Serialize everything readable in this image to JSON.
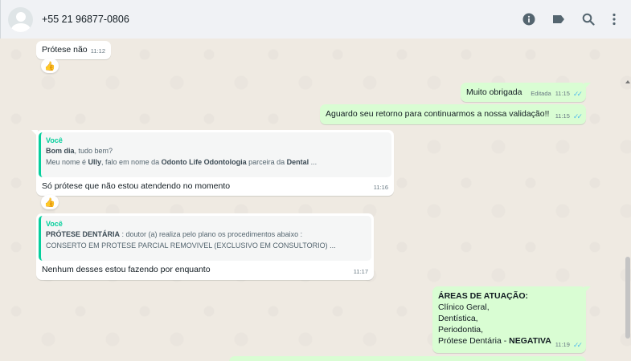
{
  "header": {
    "contact_name": "+55 21 96877-0806",
    "icons": [
      "info-icon",
      "label-icon",
      "search-icon",
      "menu-icon"
    ]
  },
  "colors": {
    "incoming": "#ffffff",
    "outgoing": "#d9fdd3",
    "accent": "#06cf9c",
    "ticks": "#53bdeb"
  },
  "messages": [
    {
      "dir": "in",
      "text": "Prótese não",
      "time": "11:12",
      "reaction": "👍"
    },
    {
      "dir": "out",
      "text": "Muito obrigada",
      "edited": "Editada",
      "time": "11:15",
      "status": "read"
    },
    {
      "dir": "out",
      "text": "Aguardo seu retorno para continuarmos a nossa validação!!",
      "time": "11:15",
      "status": "read"
    },
    {
      "dir": "in",
      "quote": {
        "author": "Você",
        "line1_bold": "Bom dia",
        "line1_rest": ", tudo bem?",
        "line2_a": "Meu nome é ",
        "line2_b": "Ully",
        "line2_c": ", falo em nome da ",
        "line2_d": "Odonto Life Odontologia",
        "line2_e": " parceira da ",
        "line2_f": "Dental",
        "line2_g": " ..."
      },
      "text": "Só prótese que não estou atendendo no momento",
      "time": "11:16",
      "reaction": "👍"
    },
    {
      "dir": "in",
      "quote": {
        "author": "Você",
        "line1_bold": "PRÓTESE DENTÁRIA",
        "line1_rest": " : doutor (a) realiza pelo plano os procedimentos abaixo :",
        "line2": "CONSERTO EM PROTESE PARCIAL REMOVIVEL (EXCLUSIVO EM CONSULTORIO) ..."
      },
      "text": "Nenhum desses estou fazendo por enquanto",
      "time": "11:17"
    },
    {
      "dir": "out",
      "title": "ÁREAS DE ATUAÇÃO:",
      "lines": [
        "Clínico Geral,",
        "Dentística,",
        "Periodontia,"
      ],
      "last_line": "Prótese Dentária - ",
      "last_bold": "NEGATIVA",
      "time": "11:19",
      "status": "read"
    }
  ]
}
